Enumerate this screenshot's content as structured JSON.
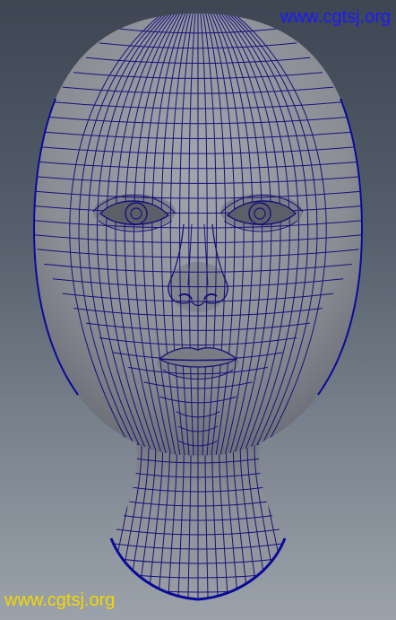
{
  "viewport": {
    "background_top": "#3d4652",
    "background_bottom": "#9ba2aa",
    "mesh_surface_color": "#8d8f96",
    "wireframe_color": "#14127a",
    "silhouette_color": "#0a0a9a",
    "content": "wireframe-head-model"
  },
  "watermark": {
    "top_text": "www.cgtsj.org",
    "top_color": "#1a1aff",
    "bottom_text": "www.cgtsj.org",
    "bottom_color": "#f5d800"
  }
}
